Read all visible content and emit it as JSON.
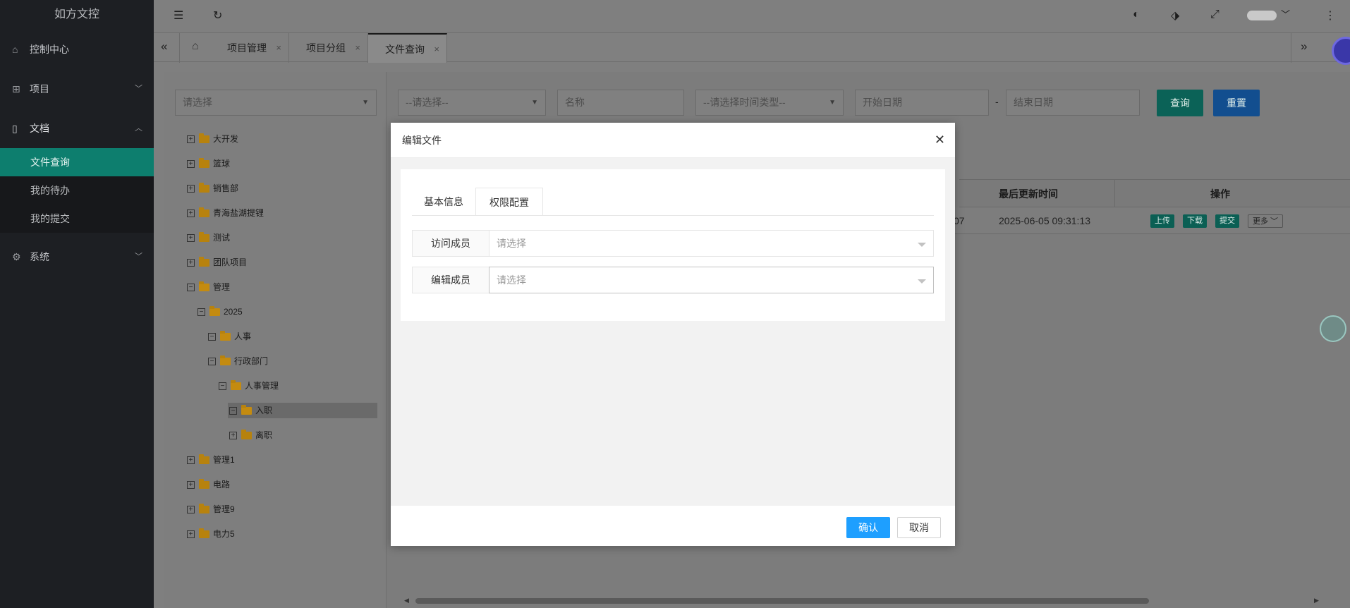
{
  "app": {
    "title": "如方文控"
  },
  "sidebar": {
    "items": [
      {
        "label": "控制中心",
        "icon": "home-icon"
      },
      {
        "label": "项目",
        "icon": "project-icon"
      },
      {
        "label": "文档",
        "icon": "document-icon"
      },
      {
        "label": "系统",
        "icon": "gear-icon"
      }
    ],
    "sub_items": [
      {
        "label": "文件查询",
        "active": true
      },
      {
        "label": "我的待办",
        "active": false
      },
      {
        "label": "我的提交",
        "active": false
      }
    ]
  },
  "tabs": [
    {
      "label": "项目管理"
    },
    {
      "label": "项目分组"
    },
    {
      "label": "文件查询",
      "active": true
    }
  ],
  "filters": {
    "tree_select_placeholder": "请选择",
    "category_placeholder": "--请选择--",
    "name_placeholder": "名称",
    "time_type_placeholder": "--请选择时间类型--",
    "start_date_placeholder": "开始日期",
    "date_separator": "-",
    "end_date_placeholder": "结束日期",
    "query_label": "查询",
    "reset_label": "重置"
  },
  "tree": [
    {
      "label": "大开发",
      "level": 0,
      "expanded": false
    },
    {
      "label": "篮球",
      "level": 0,
      "expanded": false
    },
    {
      "label": "销售部",
      "level": 0,
      "expanded": false
    },
    {
      "label": "青海盐湖提锂",
      "level": 0,
      "expanded": false
    },
    {
      "label": "测试",
      "level": 0,
      "expanded": false
    },
    {
      "label": "团队项目",
      "level": 0,
      "expanded": false
    },
    {
      "label": "管理",
      "level": 0,
      "expanded": true
    },
    {
      "label": "2025",
      "level": 1,
      "expanded": true
    },
    {
      "label": "人事",
      "level": 2,
      "expanded": true
    },
    {
      "label": "行政部门",
      "level": 2,
      "expanded": true
    },
    {
      "label": "人事管理",
      "level": 3,
      "expanded": true
    },
    {
      "label": "入职",
      "level": 4,
      "expanded": true,
      "selected": true
    },
    {
      "label": "离职",
      "level": 4,
      "expanded": false
    },
    {
      "label": "管理1",
      "level": 0,
      "expanded": false
    },
    {
      "label": "电路",
      "level": 0,
      "expanded": false
    },
    {
      "label": "管理9",
      "level": 0,
      "expanded": false
    },
    {
      "label": "电力5",
      "level": 0,
      "expanded": false
    }
  ],
  "table": {
    "headers": {
      "updated": "最后更新时间",
      "actions": "操作"
    },
    "rows": [
      {
        "partial": "07",
        "updated": "2025-06-05 09:31:13"
      }
    ],
    "row_actions": {
      "upload": "上传",
      "download": "下载",
      "submit": "提交",
      "more": "更多"
    }
  },
  "modal": {
    "title": "编辑文件",
    "tabs": [
      {
        "label": "基本信息"
      },
      {
        "label": "权限配置",
        "active": true
      }
    ],
    "fields": [
      {
        "label": "访问成员",
        "placeholder": "请选择"
      },
      {
        "label": "编辑成员",
        "placeholder": "请选择"
      }
    ],
    "confirm_label": "确认",
    "cancel_label": "取消"
  },
  "colors": {
    "sidebar_bg": "#1d1f23",
    "sidebar_active": "#0d7e6e",
    "confirm_button": "#1e9fff",
    "query_button": "#0d6e62",
    "reset_button": "#1457a0"
  }
}
